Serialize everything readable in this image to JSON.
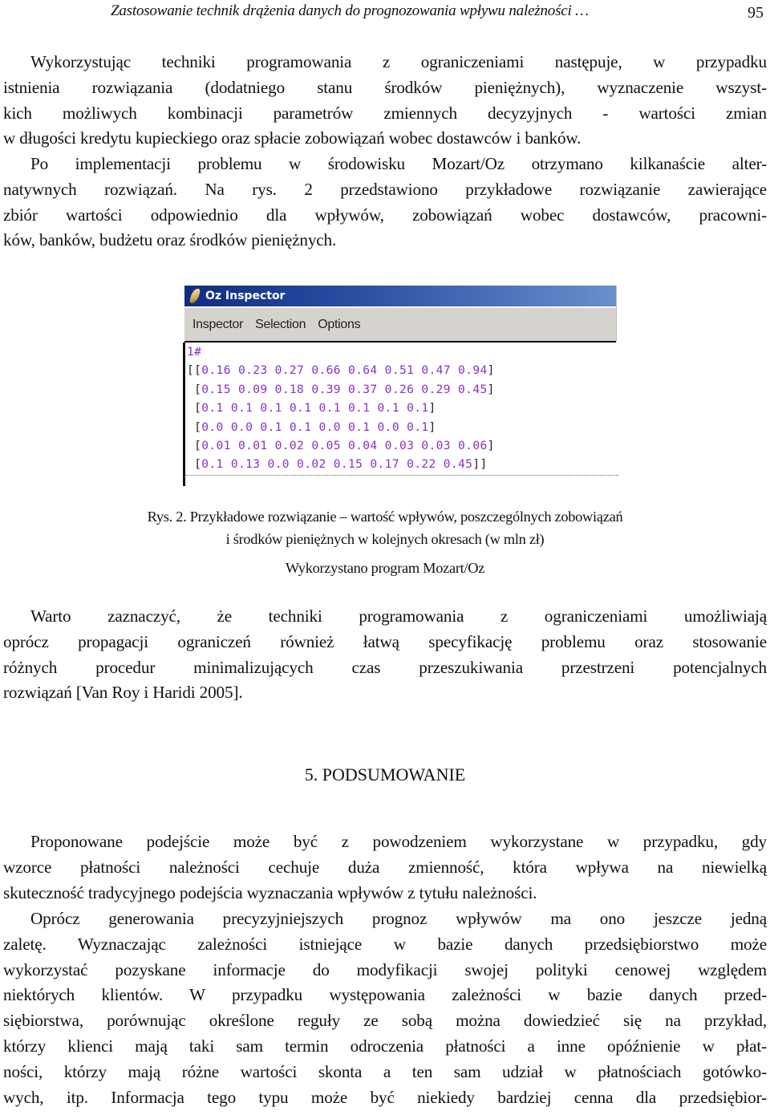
{
  "running_header": {
    "title": "Zastosowanie technik drążenia danych do prognozowania wpływu należności …",
    "page_number": "95"
  },
  "paragraphs": {
    "p1": [
      "Wykorzystując techniki programowania z ograniczeniami następuje, w przypadku",
      "istnienia rozwiązania (dodatniego stanu środków pieniężnych), wyznaczenie wszyst-",
      "kich możliwych kombinacji parametrów zmiennych decyzyjnych - wartości zmian",
      "w długości kredytu kupieckiego oraz spłacie zobowiązań wobec dostawców i banków."
    ],
    "p2": [
      "Po implementacji problemu w środowisku Mozart/Oz otrzymano kilkanaście alter-",
      "natywnych rozwiązań. Na rys. 2 przedstawiono przykładowe rozwiązanie zawierające",
      "zbiór wartości odpowiednio dla wpływów, zobowiązań wobec dostawców, pracowni-",
      "ków, banków, budżetu oraz środków pieniężnych."
    ],
    "p3": [
      "Warto zaznaczyć, że techniki programowania z ograniczeniami umożliwiają",
      "oprócz propagacji ograniczeń również łatwą specyfikację problemu oraz stosowanie",
      "różnych procedur minimalizujących czas przeszukiwania przestrzeni potencjalnych",
      "rozwiązań [Van Roy i Haridi 2005]."
    ],
    "p4": [
      "Proponowane podejście może być z powodzeniem wykorzystane w przypadku, gdy",
      "wzorce płatności należności cechuje duża zmienność, która wpływa na niewielką",
      "skuteczność tradycyjnego podejścia wyznaczania wpływów z tytułu należności."
    ],
    "p5": [
      "Oprócz generowania precyzyjniejszych prognoz wpływów ma ono jeszcze jedną",
      "zaletę. Wyznaczając zależności istniejące w bazie danych przedsiębiorstwo może",
      "wykorzystać pozyskane informacje do modyfikacji swojej polityki cenowej względem",
      "niektórych klientów. W przypadku występowania zależności w bazie danych przed-",
      "siębiorstwa, porównując określone reguły ze sobą można dowiedzieć się na przykład,",
      "którzy klienci mają taki sam termin odroczenia płatności a inne opóźnienie w płat-",
      "ności, którzy mają różne wartości skonta a ten sam udział w płatnościach gotówko-",
      "wych, itp. Informacja tego typu może być niekiedy bardziej cenna dla przedsiębior-"
    ]
  },
  "oz_inspector": {
    "title": "Oz Inspector",
    "menu": [
      "Inspector",
      "Selection",
      "Options"
    ],
    "entry_label": "1#",
    "rows": [
      [
        "0.16",
        "0.23",
        "0.27",
        "0.66",
        "0.64",
        "0.51",
        "0.47",
        "0.94"
      ],
      [
        "0.15",
        "0.09",
        "0.18",
        "0.39",
        "0.37",
        "0.26",
        "0.29",
        "0.45"
      ],
      [
        "0.1",
        "0.1",
        "0.1",
        "0.1",
        "0.1",
        "0.1",
        "0.1",
        "0.1"
      ],
      [
        "0.0",
        "0.0",
        "0.1",
        "0.1",
        "0.0",
        "0.1",
        "0.0",
        "0.1"
      ],
      [
        "0.01",
        "0.01",
        "0.02",
        "0.05",
        "0.04",
        "0.03",
        "0.03",
        "0.06"
      ],
      [
        "0.1",
        "0.13",
        "0.0",
        "0.02",
        "0.15",
        "0.17",
        "0.22",
        "0.45"
      ]
    ],
    "value_color": "#8b2fc9",
    "titlebar_color": "#0f2c84"
  },
  "figure_caption": {
    "line1": "Rys. 2. Przykładowe rozwiązanie – wartość wpływów, poszczególnych zobowiązań",
    "line2": "i środków pieniężnych w kolejnych okresach (w mln zł)",
    "source": "Wykorzystano program Mozart/Oz"
  },
  "section": {
    "heading": "5. PODSUMOWANIE"
  }
}
